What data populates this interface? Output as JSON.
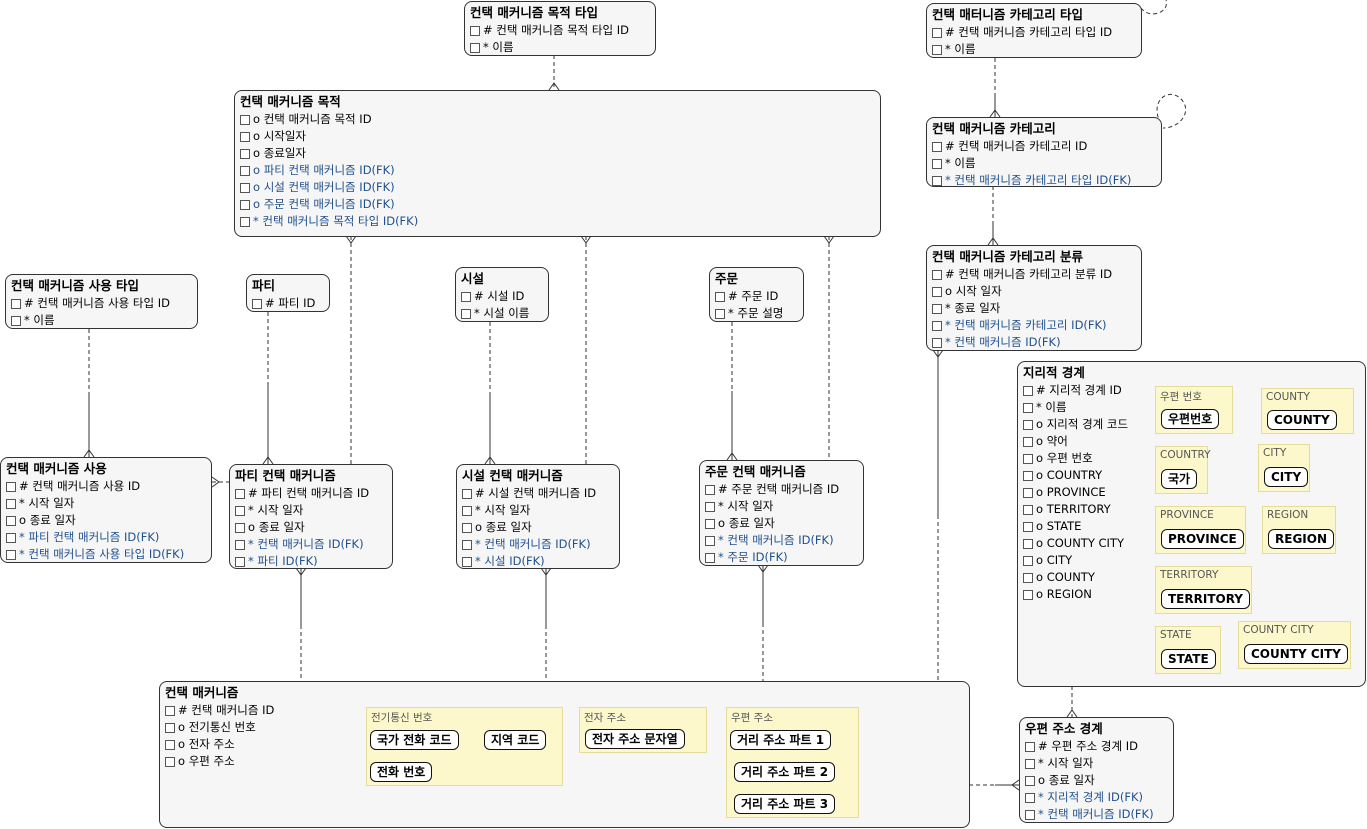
{
  "entities": {
    "purpose_type": {
      "title": "컨택 매커니즘 목적 타입",
      "attrs": [
        {
          "text": "# 컨택 매커니즘 목적 타입 ID"
        },
        {
          "text": "* 이름"
        }
      ]
    },
    "purpose": {
      "title": "컨택 매커니즘 목적",
      "attrs": [
        {
          "text": "o 컨택 매커니즘 목적 ID"
        },
        {
          "text": "o 시작일자"
        },
        {
          "text": "o 종료일자"
        },
        {
          "text": "o 파티 컨택 매커니즘 ID(FK)"
        },
        {
          "text": "o 시설 컨택 매커니즘 ID(FK)"
        },
        {
          "text": "o 주문 컨택 매커니즘 ID(FK)"
        },
        {
          "text": "* 컨택 매커니즘 목적 타입 ID(FK)"
        }
      ]
    },
    "category_type": {
      "title": "컨택 매터니즘 카테고리 타입",
      "attrs": [
        {
          "text": "# 컨택 매커니즘 카테고리 타입 ID"
        },
        {
          "text": "* 이름"
        }
      ]
    },
    "category": {
      "title": "컨택 매커니즘 카테고리",
      "attrs": [
        {
          "text": "# 컨택 매커니즘 카테고리 ID"
        },
        {
          "text": "* 이름"
        },
        {
          "text": "* 컨택 매커니즘 카테고리 타입 ID(FK)"
        }
      ]
    },
    "category_class": {
      "title": "컨택 매커니즘 카테고리 분류",
      "attrs": [
        {
          "text": "# 컨택 매커니즘 카테고리 분류 ID"
        },
        {
          "text": "o 시작 일자"
        },
        {
          "text": "* 종료 일자"
        },
        {
          "text": "* 컨택 매커니즘 카테고리 ID(FK)"
        },
        {
          "text": "* 컨택 매커니즘 ID(FK)"
        }
      ]
    },
    "usage_type": {
      "title": "컨택 매커니즘 사용 타입",
      "attrs": [
        {
          "text": "# 컨택 매커니즘 사용 타입 ID"
        },
        {
          "text": "* 이름"
        }
      ]
    },
    "party": {
      "title": "파티",
      "attrs": [
        {
          "text": "# 파티 ID"
        }
      ]
    },
    "facility": {
      "title": "시설",
      "attrs": [
        {
          "text": "# 시설 ID"
        },
        {
          "text": "* 시설 이름"
        }
      ]
    },
    "order": {
      "title": "주문",
      "attrs": [
        {
          "text": "# 주문 ID"
        },
        {
          "text": "* 주문 설명"
        }
      ]
    },
    "usage": {
      "title": "컨택 매커니즘 사용",
      "attrs": [
        {
          "text": "# 컨택 매커니즘 사용 ID"
        },
        {
          "text": "* 시작 일자"
        },
        {
          "text": "o 종료 일자"
        },
        {
          "text": "* 파티 컨택 매커니즘 ID(FK)"
        },
        {
          "text": "* 컨택 매커니즘 사용 타입 ID(FK)"
        }
      ]
    },
    "party_cm": {
      "title": "파티 컨택 매커니즘",
      "attrs": [
        {
          "text": "# 파티 컨택 매커니즘 ID"
        },
        {
          "text": "* 시작 일자"
        },
        {
          "text": "o 종료 일자"
        },
        {
          "text": "* 컨택 매커니즘 ID(FK)"
        },
        {
          "text": "* 파티 ID(FK)"
        }
      ]
    },
    "facility_cm": {
      "title": "시설 컨택 매커니즘",
      "attrs": [
        {
          "text": "# 시설 컨택 매커니즘 ID"
        },
        {
          "text": "* 시작 일자"
        },
        {
          "text": "o 종료 일자"
        },
        {
          "text": "* 컨택 매커니즘 ID(FK)"
        },
        {
          "text": "* 시설 ID(FK)"
        }
      ]
    },
    "order_cm": {
      "title": "주문 컨택 매커니즘",
      "attrs": [
        {
          "text": "# 주문 컨택 매커니즘 ID"
        },
        {
          "text": "* 시작 일자"
        },
        {
          "text": "o 종료 일자"
        },
        {
          "text": "* 컨택 매커니즘 ID(FK)"
        },
        {
          "text": "* 주문 ID(FK)"
        }
      ]
    },
    "geo": {
      "title": "지리적 경계",
      "attrs": [
        {
          "text": "# 지리적 경계 ID"
        },
        {
          "text": "* 이름"
        },
        {
          "text": "o 지리적 경계 코드"
        },
        {
          "text": "o 약어"
        },
        {
          "text": "o 우편 번호"
        },
        {
          "text": "o COUNTRY"
        },
        {
          "text": "o PROVINCE"
        },
        {
          "text": "o TERRITORY"
        },
        {
          "text": "o STATE"
        },
        {
          "text": "o COUNTY CITY"
        },
        {
          "text": "o CITY"
        },
        {
          "text": "o COUNTY"
        },
        {
          "text": "o REGION"
        }
      ]
    },
    "contact": {
      "title": "컨택 매커니즘",
      "attrs": [
        {
          "text": "# 컨택 매커니즘 ID"
        },
        {
          "text": "o 전기통신 번호"
        },
        {
          "text": "o 전자 주소"
        },
        {
          "text": "o 우편 주소"
        }
      ]
    },
    "postal_boundary": {
      "title": "우편 주소 경계",
      "attrs": [
        {
          "text": "# 우편 주소 경계 ID"
        },
        {
          "text": "* 시작 일자"
        },
        {
          "text": "o 종료 일자"
        },
        {
          "text": "* 지리적 경계 ID(FK)"
        },
        {
          "text": "* 컨택 매커니즘 ID(FK)"
        }
      ]
    }
  },
  "subtypes": {
    "postal_code": {
      "label": "우편 번호",
      "pill": "우편번호"
    },
    "county": {
      "label": "COUNTY",
      "pill": "COUNTY"
    },
    "country": {
      "label": "COUNTRY",
      "pill": "국가"
    },
    "city": {
      "label": "CITY",
      "pill": "CITY"
    },
    "province": {
      "label": "PROVINCE",
      "pill": "PROVINCE"
    },
    "region": {
      "label": "REGION",
      "pill": "REGION"
    },
    "territory": {
      "label": "TERRITORY",
      "pill": "TERRITORY"
    },
    "state": {
      "label": "STATE",
      "pill": "STATE"
    },
    "county_city": {
      "label": "COUNTY CITY",
      "pill": "COUNTY CITY"
    },
    "telecom": {
      "label": "전기통신 번호",
      "pills": [
        "국가 전화 코드",
        "지역 코드",
        "전화 번호"
      ]
    },
    "email": {
      "label": "전자 주소",
      "pills": [
        "전자 주소 문자열"
      ]
    },
    "postal_addr": {
      "label": "우편 주소",
      "pills": [
        "거리 주소 파트 1",
        "거리 주소 파트 2",
        "거리 주소 파트 3"
      ]
    }
  }
}
